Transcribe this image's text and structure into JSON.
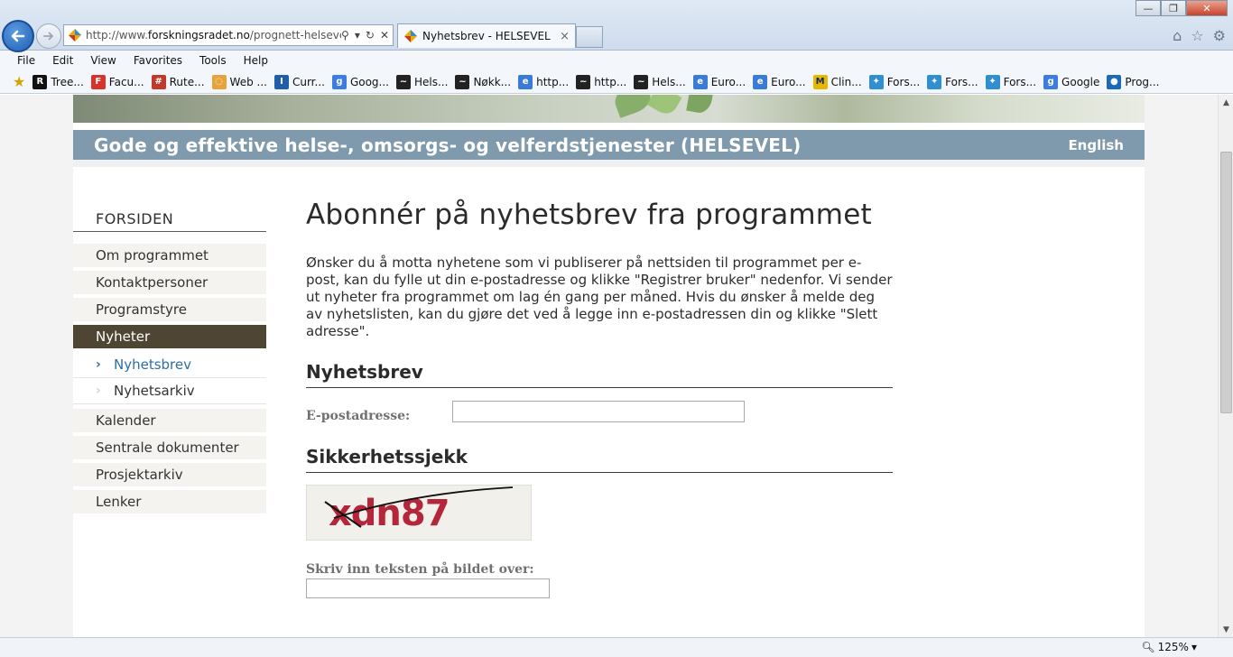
{
  "browser": {
    "url_prefix": "http://www.",
    "url_domain": "forskningsradet.no",
    "url_path": "/prognett-helsevel/I",
    "tab_title": "Nyhetsbrev - HELSEVEL",
    "tab_close": "×",
    "menu": [
      "File",
      "Edit",
      "View",
      "Favorites",
      "Tools",
      "Help"
    ],
    "favorites": [
      {
        "label": "Tree...",
        "icon": "R",
        "color": "#111111"
      },
      {
        "label": "Facu...",
        "icon": "F",
        "color": "#d9322b"
      },
      {
        "label": "Rute...",
        "icon": "#",
        "color": "#ffffff"
      },
      {
        "label": "Web ...",
        "icon": "◌",
        "color": "#e8a23a"
      },
      {
        "label": "Curr...",
        "icon": "I",
        "color": "#1f5ea8"
      },
      {
        "label": "Goog...",
        "icon": "g",
        "color": "#3d7ce0"
      },
      {
        "label": "Hels...",
        "icon": "~",
        "color": "#222222"
      },
      {
        "label": "Nøkk...",
        "icon": "~",
        "color": "#222222"
      },
      {
        "label": "http...",
        "icon": "e",
        "color": "#3a7bd5"
      },
      {
        "label": "http...",
        "icon": "~",
        "color": "#222222"
      },
      {
        "label": "Hels...",
        "icon": "~",
        "color": "#222222"
      },
      {
        "label": "Euro...",
        "icon": "e",
        "color": "#3a7bd5"
      },
      {
        "label": "Euro...",
        "icon": "e",
        "color": "#3a7bd5"
      },
      {
        "label": "Clin...",
        "icon": "M",
        "color": "#e6b800"
      },
      {
        "label": "Fors...",
        "icon": "✦",
        "color": "#2f8fd0"
      },
      {
        "label": "Fors...",
        "icon": "✦",
        "color": "#2f8fd0"
      },
      {
        "label": "Fors...",
        "icon": "✦",
        "color": "#2f8fd0"
      },
      {
        "label": "Google",
        "icon": "g",
        "color": "#3d7ce0"
      },
      {
        "label": "Prog...",
        "icon": "●",
        "color": "#1a6ab8"
      }
    ],
    "zoom": "125%"
  },
  "header": {
    "title": "Gode og effektive helse-, omsorgs- og velferdstjenester (HELSEVEL)",
    "language_link": "English"
  },
  "nav": {
    "home": "FORSIDEN",
    "items_before": [
      "Om programmet",
      "Kontaktpersoner",
      "Programstyre"
    ],
    "active": "Nyheter",
    "sub_current": "Nyhetsbrev",
    "sub_other": "Nyhetsarkiv",
    "items_after": [
      "Kalender",
      "Sentrale dokumenter",
      "Prosjektarkiv",
      "Lenker"
    ]
  },
  "main": {
    "title": "Abonnér på nyhetsbrev fra programmet",
    "intro": "Ønsker du å motta nyhetene som vi publiserer på nettsiden til programmet per e-post, kan du fylle ut din e-postadresse og klikke \"Registrer bruker\" nedenfor. Vi sender ut nyheter fra programmet om lag én gang per måned. Hvis du ønsker å melde deg av nyhetslisten, kan du gjøre det ved å legge inn e-postadressen din og klikke \"Slett adresse\".",
    "section_newsletter": "Nyhetsbrev",
    "email_label": "E-postadresse:",
    "email_value": "",
    "section_security": "Sikkerhetssjekk",
    "captcha_text": "xdn87",
    "captcha_label": "Skriv inn teksten på bildet over:",
    "captcha_value": ""
  },
  "colors": {
    "header_bar": "#7f9aac",
    "nav_active": "#4e4632",
    "link_blue": "#2c6ea6"
  }
}
